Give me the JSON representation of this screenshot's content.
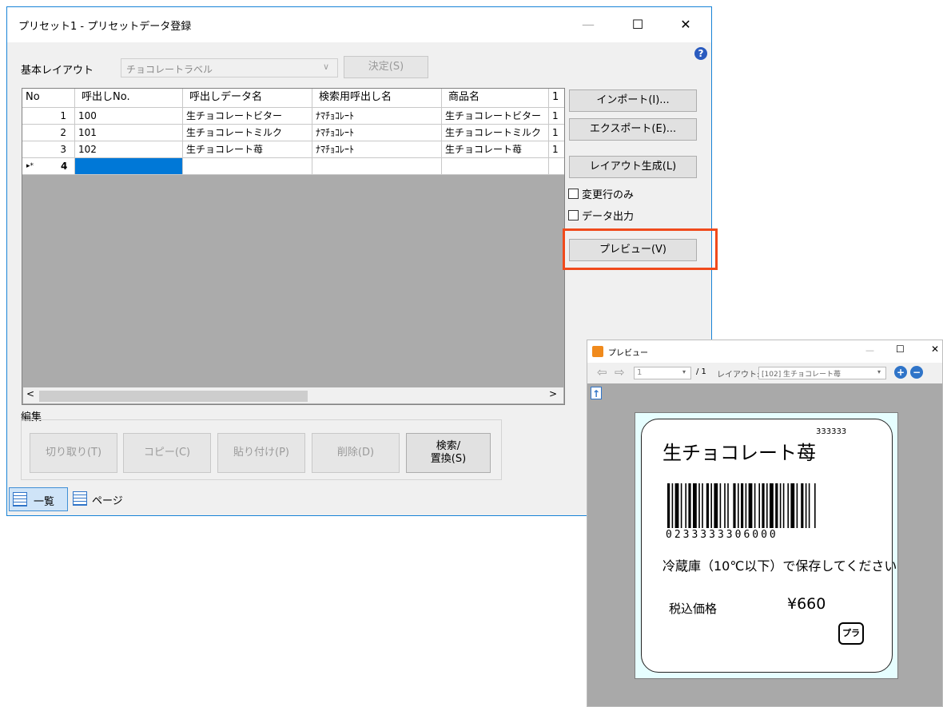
{
  "main_window": {
    "title": "プリセット1 - プリセットデータ登録",
    "controls": {
      "minimize": "—",
      "maximize": "☐",
      "close": "✕"
    },
    "help_icon": "?",
    "base_layout": {
      "label": "基本レイアウト",
      "value": "チョコレートラベル",
      "decide_button": "決定(S)"
    },
    "grid": {
      "headers": [
        "No",
        "呼出しNo.",
        "呼出しデータ名",
        "検索用呼出し名",
        "商品名",
        "1"
      ],
      "rows": [
        {
          "no": "1",
          "call_no": "100",
          "data_name": "生チョコレートビター",
          "search_name": "ﾅﾏﾁｮｺﾚｰﾄ",
          "product": "生チョコレートビター",
          "extra": "1"
        },
        {
          "no": "2",
          "call_no": "101",
          "data_name": "生チョコレートミルク",
          "search_name": "ﾅﾏﾁｮｺﾚｰﾄ",
          "product": "生チョコレートミルク",
          "extra": "1"
        },
        {
          "no": "3",
          "call_no": "102",
          "data_name": "生チョコレート苺",
          "search_name": "ﾅﾏﾁｮｺﾚｰﾄ",
          "product": "生チョコレート苺",
          "extra": "1"
        }
      ],
      "new_row": {
        "marker": "▸*",
        "no": "4"
      }
    },
    "side_buttons": {
      "import": "インポート(I)...",
      "export": "エクスポート(E)...",
      "generate_layout": "レイアウト生成(L)",
      "changed_rows_only": "変更行のみ",
      "data_output": "データ出力",
      "preview": "プレビュー(V)"
    },
    "edit_group": {
      "label": "編集",
      "cut": "切り取り(T)",
      "copy": "コピー(C)",
      "paste": "貼り付け(P)",
      "delete": "削除(D)",
      "search_replace_1": "検索/",
      "search_replace_2": "置換(S)"
    },
    "view_tabs": {
      "list": "一覧",
      "page": "ページ"
    }
  },
  "preview_window": {
    "title": "プレビュー",
    "controls": {
      "minimize": "—",
      "maximize": "☐",
      "close": "✕"
    },
    "toolbar": {
      "page": "1",
      "page_total": "/ 1",
      "layout_label": "レイアウト:",
      "layout_value": "[102] 生チョコレート苺"
    },
    "label": {
      "code_top": "333333",
      "product_name": "生チョコレート苺",
      "barcode_digits": "0233333306000",
      "storage_note": "冷蔵庫（10℃以下）で保存してください",
      "price_label": "税込価格",
      "price_value": "¥660",
      "recycle_mark": "プラ"
    }
  }
}
